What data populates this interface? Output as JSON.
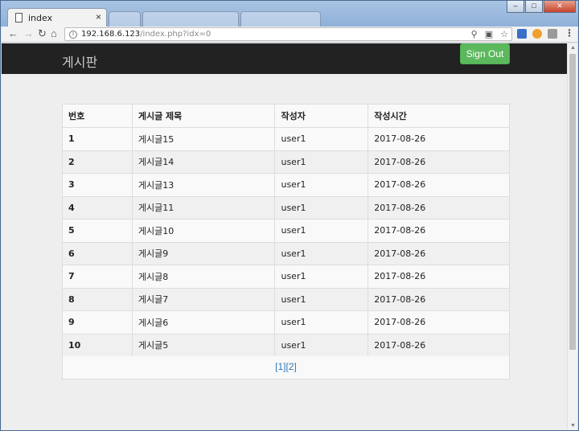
{
  "browser": {
    "tab_title": "index",
    "tab_close": "×",
    "address_host": "192.168.6.123",
    "address_path": "/index.php?idx=0",
    "win_minimize": "–",
    "win_restore": "□",
    "win_close": "✕"
  },
  "navbar": {
    "brand": "게시판",
    "signout_label": "Sign Out"
  },
  "table": {
    "headers": [
      "번호",
      "게시글 제목",
      "작성자",
      "작성시간"
    ],
    "rows": [
      {
        "no": "1",
        "title": "게시글15",
        "author": "user1",
        "date": "2017-08-26"
      },
      {
        "no": "2",
        "title": "게시글14",
        "author": "user1",
        "date": "2017-08-26"
      },
      {
        "no": "3",
        "title": "게시글13",
        "author": "user1",
        "date": "2017-08-26"
      },
      {
        "no": "4",
        "title": "게시글11",
        "author": "user1",
        "date": "2017-08-26"
      },
      {
        "no": "5",
        "title": "게시글10",
        "author": "user1",
        "date": "2017-08-26"
      },
      {
        "no": "6",
        "title": "게시글9",
        "author": "user1",
        "date": "2017-08-26"
      },
      {
        "no": "7",
        "title": "게시글8",
        "author": "user1",
        "date": "2017-08-26"
      },
      {
        "no": "8",
        "title": "게시글7",
        "author": "user1",
        "date": "2017-08-26"
      },
      {
        "no": "9",
        "title": "게시글6",
        "author": "user1",
        "date": "2017-08-26"
      },
      {
        "no": "10",
        "title": "게시글5",
        "author": "user1",
        "date": "2017-08-26"
      }
    ]
  },
  "pagination": {
    "pages": [
      "[1]",
      "[2]"
    ]
  },
  "colors": {
    "navbar_bg": "#222222",
    "signout_bg": "#5cb85c",
    "link": "#337ab7",
    "page_bg": "#eeeeee"
  },
  "icons": [
    "document-icon",
    "back-icon",
    "forward-icon",
    "reload-icon",
    "home-icon",
    "info-icon",
    "zoom-icon",
    "translate-icon",
    "star-icon",
    "menu-icon"
  ]
}
